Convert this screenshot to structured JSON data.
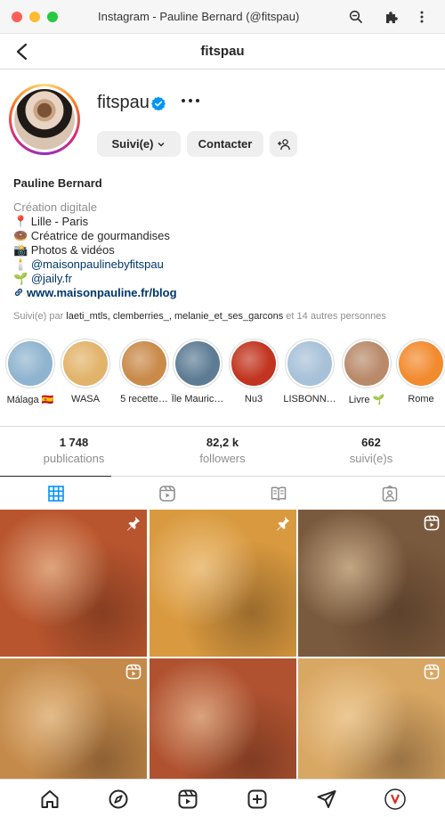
{
  "window": {
    "title": "Instagram - Pauline Bernard (@fitspau)"
  },
  "header": {
    "title": "fitspau"
  },
  "profile": {
    "username": "fitspau",
    "verified": true,
    "follow_label": "Suivi(e)",
    "contact_label": "Contacter",
    "full_name": "Pauline Bernard",
    "bio": {
      "category": "Création digitale",
      "line1": "📍 Lille - Paris",
      "line2": "🍩 Créatrice de gourmandises",
      "line3": "📸 Photos & vidéos",
      "line4_emoji": "🕯️",
      "line4_mention": "@maisonpaulinebyfitspau",
      "line5_emoji": "🌱",
      "line5_mention": "@jaily.fr",
      "link": "www.maisonpauline.fr/blog"
    },
    "followed_by": {
      "prefix": "Suivi(e) par ",
      "names": "laeti_mtls, clemberries_, melanie_et_ses_garcons",
      "suffix": " et 14 autres personnes"
    }
  },
  "highlights": [
    {
      "label": "Málaga 🇪🇸",
      "color": "#8fb4cf"
    },
    {
      "label": "WASA",
      "color": "#e2b36a"
    },
    {
      "label": "5 recette…",
      "color": "#c98a4a"
    },
    {
      "label": "Île Mauric…",
      "color": "#5d7c94"
    },
    {
      "label": "Nu3",
      "color": "#c1341f"
    },
    {
      "label": "LISBONN…",
      "color": "#a7c1d8"
    },
    {
      "label": "Livre 🌱",
      "color": "#b88a6a"
    },
    {
      "label": "Rome",
      "color": "#f28a2e"
    }
  ],
  "stats": {
    "posts_value": "1 748",
    "posts_label": "publications",
    "followers_value": "82,2 k",
    "followers_label": "followers",
    "following_value": "662",
    "following_label": "suivi(e)s"
  },
  "tabs": [
    "posts-grid",
    "reels",
    "guides",
    "tagged"
  ],
  "posts": [
    {
      "name": "pizza-post",
      "badge": "pin",
      "color": "#b9552e"
    },
    {
      "name": "crepe-post",
      "badge": "pin",
      "color": "#d99a3f"
    },
    {
      "name": "cookies-post",
      "badge": "reel",
      "color": "#7a5a3e"
    },
    {
      "name": "apple-tart-post",
      "badge": "reel",
      "color": "#c48a4a"
    },
    {
      "name": "portrait-post",
      "badge": "",
      "color": "#b05230"
    },
    {
      "name": "pasta-post",
      "badge": "reel",
      "color": "#d8a763"
    }
  ],
  "colors": {
    "accent": "#0095f6",
    "link": "#00376b",
    "muted": "#8e8e8e"
  }
}
